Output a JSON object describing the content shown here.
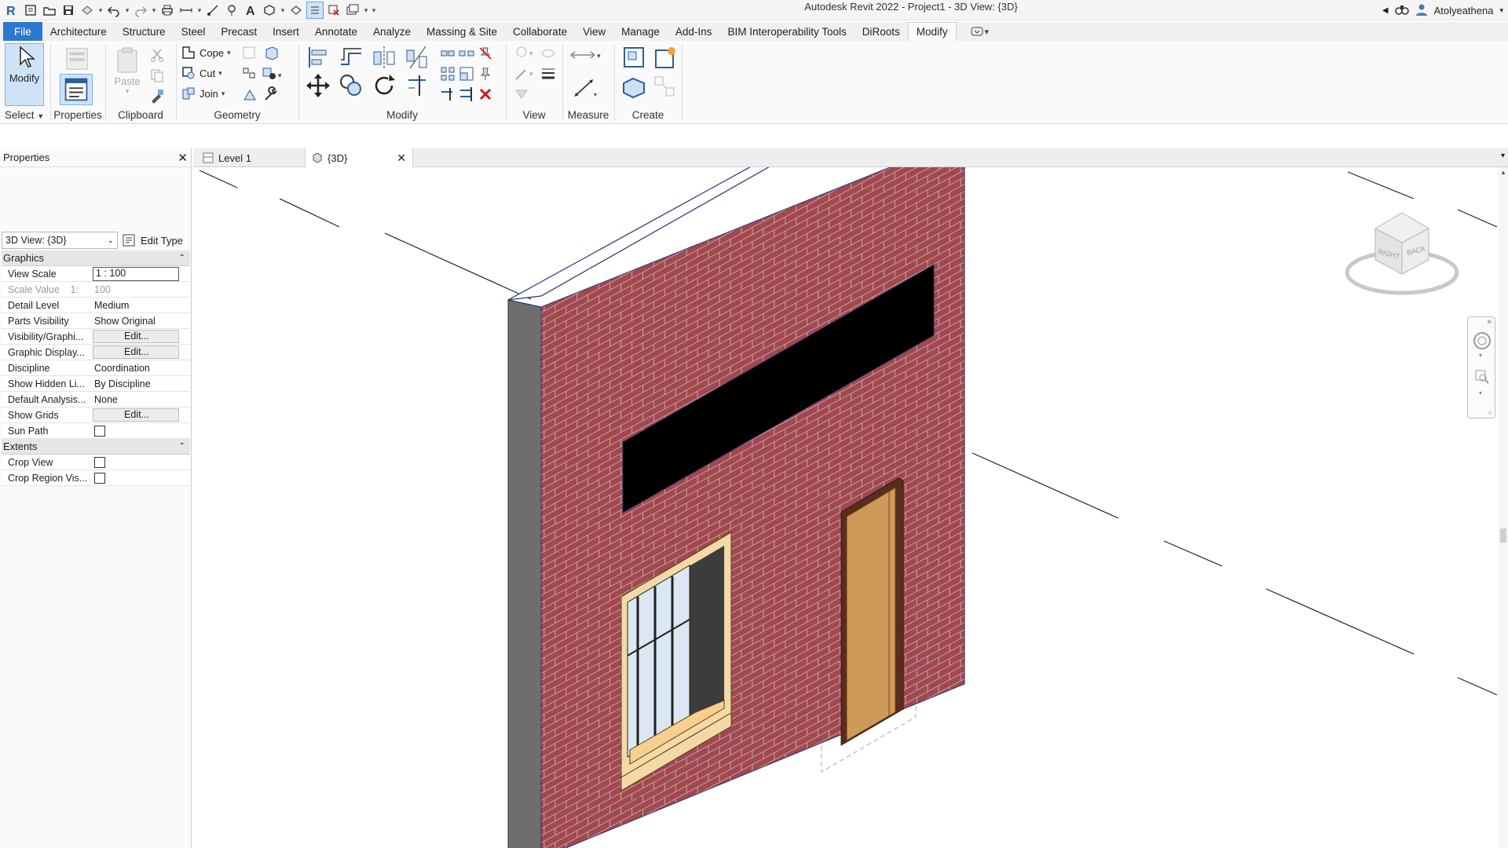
{
  "app": {
    "title": "Autodesk Revit 2022 - Project1 - 3D View: {3D}",
    "user": "Atolyeathena"
  },
  "ribbon": {
    "tabs": [
      "File",
      "Architecture",
      "Structure",
      "Steel",
      "Precast",
      "Insert",
      "Annotate",
      "Analyze",
      "Massing & Site",
      "Collaborate",
      "View",
      "Manage",
      "Add-Ins",
      "BIM Interoperability Tools",
      "DiRoots",
      "Modify"
    ],
    "active_tab": "Modify",
    "panels": {
      "select": {
        "label": "Select",
        "modify": "Modify"
      },
      "properties": {
        "label": "Properties",
        "properties": "Properties"
      },
      "clipboard": {
        "label": "Clipboard",
        "paste": "Paste"
      },
      "geometry": {
        "label": "Geometry",
        "cope": "Cope",
        "cut": "Cut",
        "join": "Join"
      },
      "modify": {
        "label": "Modify"
      },
      "view": {
        "label": "View"
      },
      "measure": {
        "label": "Measure"
      },
      "create": {
        "label": "Create"
      }
    }
  },
  "properties": {
    "title": "Properties",
    "type_selector": "3D View: {3D}",
    "edit_type": "Edit Type",
    "groups": [
      {
        "name": "Graphics",
        "rows": [
          {
            "name": "View Scale",
            "value": "1 : 100",
            "kind": "input"
          },
          {
            "name": "Scale Value    1:",
            "value": "100",
            "kind": "grey"
          },
          {
            "name": "Detail Level",
            "value": "Medium",
            "kind": "text"
          },
          {
            "name": "Parts Visibility",
            "value": "Show Original",
            "kind": "text"
          },
          {
            "name": "Visibility/Graphi...",
            "value": "Edit...",
            "kind": "button"
          },
          {
            "name": "Graphic Display...",
            "value": "Edit...",
            "kind": "button"
          },
          {
            "name": "Discipline",
            "value": "Coordination",
            "kind": "text"
          },
          {
            "name": "Show Hidden Li...",
            "value": "By Discipline",
            "kind": "text"
          },
          {
            "name": "Default Analysis...",
            "value": "None",
            "kind": "text"
          },
          {
            "name": "Show Grids",
            "value": "Edit...",
            "kind": "button"
          },
          {
            "name": "Sun Path",
            "value": "",
            "kind": "checkbox"
          }
        ]
      },
      {
        "name": "Extents",
        "rows": [
          {
            "name": "Crop View",
            "value": "",
            "kind": "checkbox"
          },
          {
            "name": "Crop Region Vis...",
            "value": "",
            "kind": "checkbox"
          }
        ]
      }
    ]
  },
  "view_tabs": [
    {
      "label": "Level 1",
      "active": false
    },
    {
      "label": "{3D}",
      "active": true
    }
  ],
  "viewcube": {
    "face_right": "RIGHT",
    "face_back": "BACK"
  },
  "colors": {
    "file_tab": "#2b78cf",
    "brick": "#a2484f",
    "mortar": "#caa7aa",
    "door": "#cf9a59",
    "glass": "#dbe7f3",
    "frame": "#f2d9a6"
  },
  "icons": [
    "revit-logo-icon",
    "save-icon",
    "undo-icon",
    "redo-icon",
    "print-icon",
    "text-icon",
    "cursor-icon",
    "paste-icon",
    "move-icon",
    "rotate-icon",
    "delete-icon",
    "measure-icon",
    "viewcube-icon",
    "steering-wheel-icon",
    "zoom-icon",
    "user-icon",
    "close-icon"
  ]
}
